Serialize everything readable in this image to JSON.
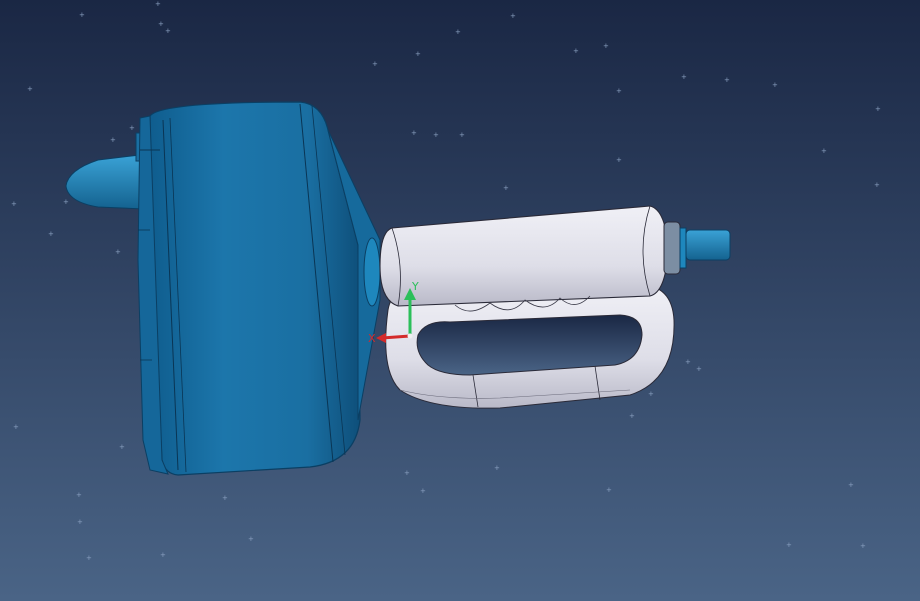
{
  "viewport": {
    "background_top": "#1a2744",
    "background_bottom": "#4a6486"
  },
  "model": {
    "drum_color": "#1a6fa2",
    "drum_shadow": "#0e4f7a",
    "handle_color": "#e3e3ec",
    "handle_shadow": "#a8a8b8",
    "edge_color": "#1f1f2a",
    "shaft_color": "#2a8bc2"
  },
  "compass": {
    "x_label": "X",
    "y_label": "Y",
    "x_color": "#d42a2a",
    "y_color": "#2bbf5a"
  }
}
